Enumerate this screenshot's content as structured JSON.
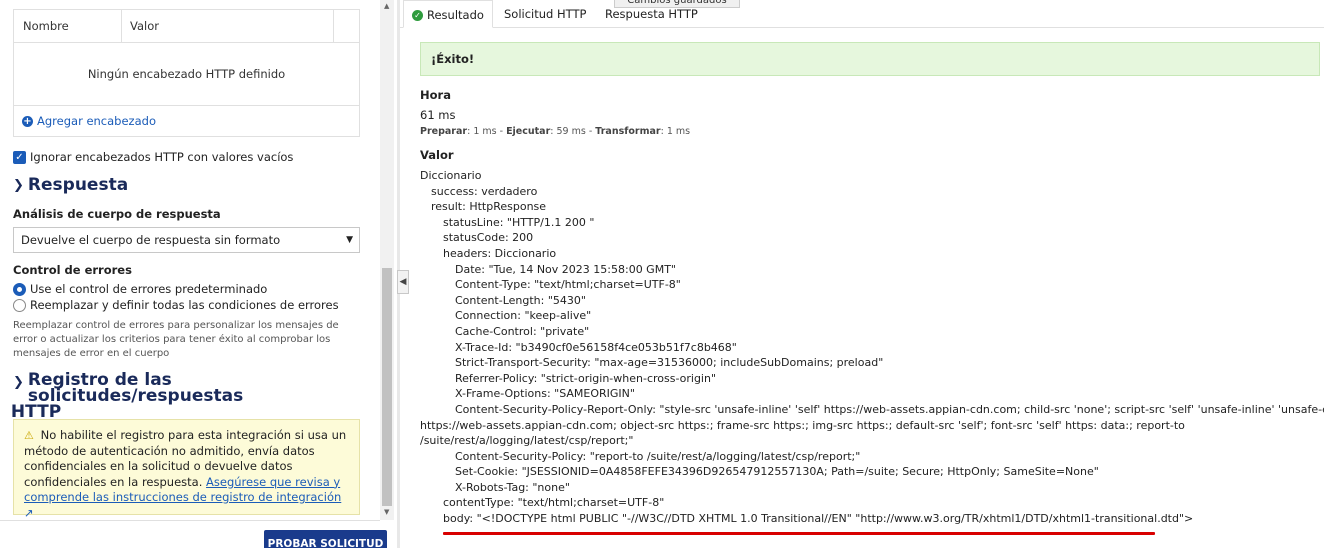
{
  "left": {
    "table": {
      "col_name": "Nombre",
      "col_value": "Valor",
      "empty": "Ningún encabezado HTTP definido"
    },
    "add_header": "Agregar encabezado",
    "ignore_empty": "Ignorar encabezados HTTP con valores vacíos",
    "response_section": "Respuesta",
    "parse_label": "Análisis de cuerpo de respuesta",
    "parse_value": "Devuelve el cuerpo de respuesta sin formato",
    "error_label": "Control de errores",
    "error_opt1": "Use el control de errores predeterminado",
    "error_opt2": "Reemplazar y definir todas las condiciones de errores",
    "error_help": "Reemplazar control de errores para personalizar los mensajes de error o actualizar los criterios para tener éxito al comprobar los mensajes de error en el cuerpo",
    "log_section_1": "Registro de las solicitudes/respuestas",
    "log_section_2": "HTTP",
    "warning_text": "No habilite el registro para esta integración si usa un método de autenticación no admitido, envía datos confidenciales en la solicitud o devuelve datos confidenciales en la respuesta.",
    "warning_link": "Asegúrese que revisa y comprende las instrucciones de registro de integración",
    "test_button": "PROBAR SOLICITUD"
  },
  "right": {
    "tabs": [
      "Resultado",
      "Solicitud HTTP",
      "Respuesta HTTP"
    ],
    "toast": "Cambios guardados",
    "success": "¡Éxito!",
    "time_label": "Hora",
    "time_value": "61 ms",
    "timing": {
      "prep_label": "Preparar",
      "prep": ": 1 ms - ",
      "exec_label": "Ejecutar",
      "exec": ": 59 ms - ",
      "fmt_label": "Transformar",
      "fmt": ": 1 ms"
    },
    "value_label": "Valor",
    "tree": {
      "root": "Diccionario",
      "success": "success: verdadero",
      "result": "result: HttpResponse",
      "statusLine": "statusLine: \"HTTP/1.1 200 \"",
      "statusCode": "statusCode: 200",
      "headers": "headers: Diccionario",
      "date": "Date: \"Tue, 14 Nov 2023 15:58:00 GMT\"",
      "ctype": "Content-Type: \"text/html;charset=UTF-8\"",
      "clen": "Content-Length: \"5430\"",
      "conn": "Connection: \"keep-alive\"",
      "cache": "Cache-Control: \"private\"",
      "trace": "X-Trace-Id: \"b3490cf0e56158f4ce053b51f7c8b468\"",
      "sts": "Strict-Transport-Security: \"max-age=31536000; includeSubDomains; preload\"",
      "referrer": "Referrer-Policy: \"strict-origin-when-cross-origin\"",
      "xframe": "X-Frame-Options: \"SAMEORIGIN\"",
      "cspro_1": "Content-Security-Policy-Report-Only: \"style-src 'unsafe-inline' 'self' https://web-assets.appian-cdn.com; child-src 'none'; script-src 'self' 'unsafe-inline' 'unsafe-eval'",
      "cspro_2": "https://web-assets.appian-cdn.com; object-src https:; frame-src https:; img-src https:; default-src 'self'; font-src 'self' https: data:; report-to",
      "cspro_3": "/suite/rest/a/logging/latest/csp/report;\"",
      "csp": "Content-Security-Policy: \"report-to /suite/rest/a/logging/latest/csp/report;\"",
      "cookie": "Set-Cookie: \"JSESSIONID=0A4858FEFE34396D926547912557130A; Path=/suite; Secure; HttpOnly; SameSite=None\"",
      "robots": "X-Robots-Tag: \"none\"",
      "contentType": "contentType: \"text/html;charset=UTF-8\"",
      "body": "body: \"<!DOCTYPE html PUBLIC \"-//W3C//DTD XHTML 1.0 Transitional//EN\" \"http://www.w3.org/TR/xhtml1/DTD/xhtml1-transitional.dtd\">"
    }
  },
  "colors": {
    "accent": "#1b5cb8",
    "heading": "#1a2a5a",
    "success_bg": "#e6f7dd",
    "warning_bg": "#fdfbd8",
    "highlight": "#d80000",
    "button": "#1a3b8c"
  },
  "icons": [
    "plus-circle-icon",
    "checkbox-checked-icon",
    "chevron-down-icon",
    "warning-icon",
    "external-link-icon",
    "check-circle-icon",
    "chevron-left-icon"
  ]
}
